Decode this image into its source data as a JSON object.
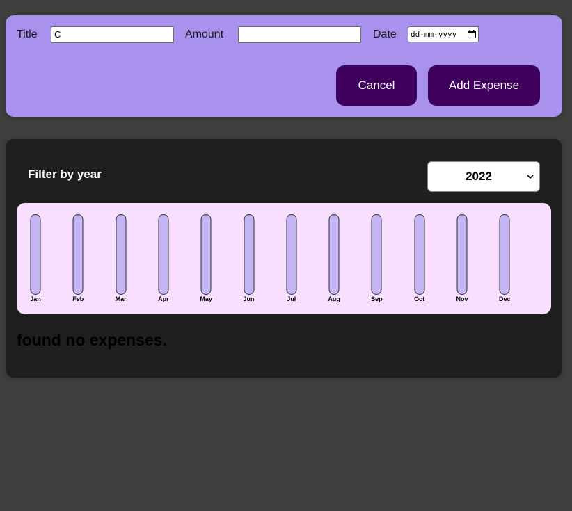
{
  "form": {
    "title_label": "Title",
    "title_value": "C",
    "amount_label": "Amount",
    "amount_value": "",
    "date_label": "Date",
    "date_placeholder": "dd-mm-yyyy",
    "cancel_label": "Cancel",
    "add_label": "Add Expense"
  },
  "filter": {
    "label": "Filter by year",
    "selected_year": "2022"
  },
  "chart": {
    "months": [
      "Jan",
      "Feb",
      "Mar",
      "Apr",
      "May",
      "Jun",
      "Jul",
      "Aug",
      "Sep",
      "Oct",
      "Nov",
      "Dec"
    ],
    "fill_fractions": [
      0,
      0,
      0,
      0,
      0,
      0,
      0,
      0,
      0,
      0,
      0,
      0
    ]
  },
  "empty_message": "found no expenses.",
  "colors": {
    "form_bg": "#a892ee",
    "button_bg": "#40005d",
    "panel_bg": "#1f1f1f",
    "chart_bg": "#f8dfff",
    "bar_track": "#c3b4f3"
  },
  "icons": {
    "date": "calendar-icon",
    "select": "chevron-down-icon"
  }
}
